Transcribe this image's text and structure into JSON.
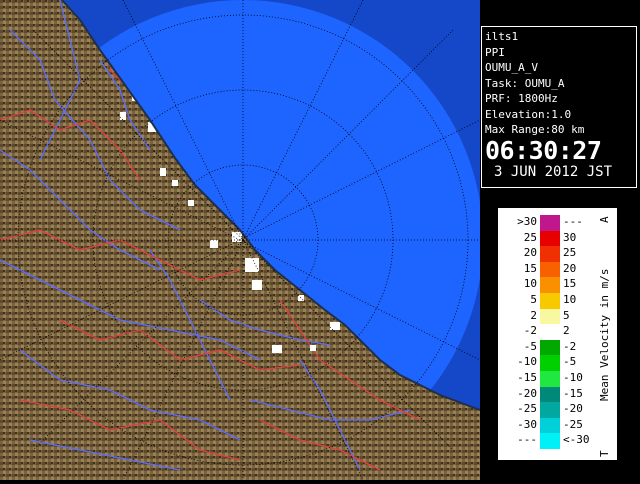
{
  "info": {
    "station": "ilts1",
    "mode": "PPI",
    "scan": "OUMU_A_V",
    "task": "Task: OUMU_A",
    "prf": "PRF: 1800Hz",
    "elevation": "Elevation:1.0",
    "max_range": "Max Range:80 km",
    "time": "06:30:27",
    "date": "3 JUN 2012 JST"
  },
  "legend": {
    "title": "Mean Velocity in m/s",
    "top_marker": "A",
    "bottom_marker": "T",
    "rows": [
      {
        "left": ">30",
        "right": "---",
        "color": "#c0188c"
      },
      {
        "left": "25",
        "right": "30",
        "color": "#e80000"
      },
      {
        "left": "20",
        "right": "25",
        "color": "#f03000"
      },
      {
        "left": "15",
        "right": "20",
        "color": "#f86000"
      },
      {
        "left": "10",
        "right": "15",
        "color": "#f89000"
      },
      {
        "left": "5",
        "right": "10",
        "color": "#f8c800"
      },
      {
        "left": "2",
        "right": "5",
        "color": "#f8f8a0"
      },
      {
        "left": "-2",
        "right": "2",
        "color": "#ffffff"
      },
      {
        "left": "-5",
        "right": "-2",
        "color": "#00a800"
      },
      {
        "left": "-10",
        "right": "-5",
        "color": "#00d000"
      },
      {
        "left": "-15",
        "right": "-10",
        "color": "#20e840"
      },
      {
        "left": "-20",
        "right": "-15",
        "color": "#008878"
      },
      {
        "left": "-25",
        "right": "-20",
        "color": "#00a8a0"
      },
      {
        "left": "-30",
        "right": "-25",
        "color": "#00d0d8"
      },
      {
        "left": "---",
        "right": "<-30",
        "color": "#00f0f8"
      }
    ]
  },
  "colors": {
    "sea": "#1e64ff",
    "sea_outer": "#1448c8",
    "land": "#7a6440",
    "rivers": "#5a6cff",
    "boundaries": "#e04040"
  }
}
